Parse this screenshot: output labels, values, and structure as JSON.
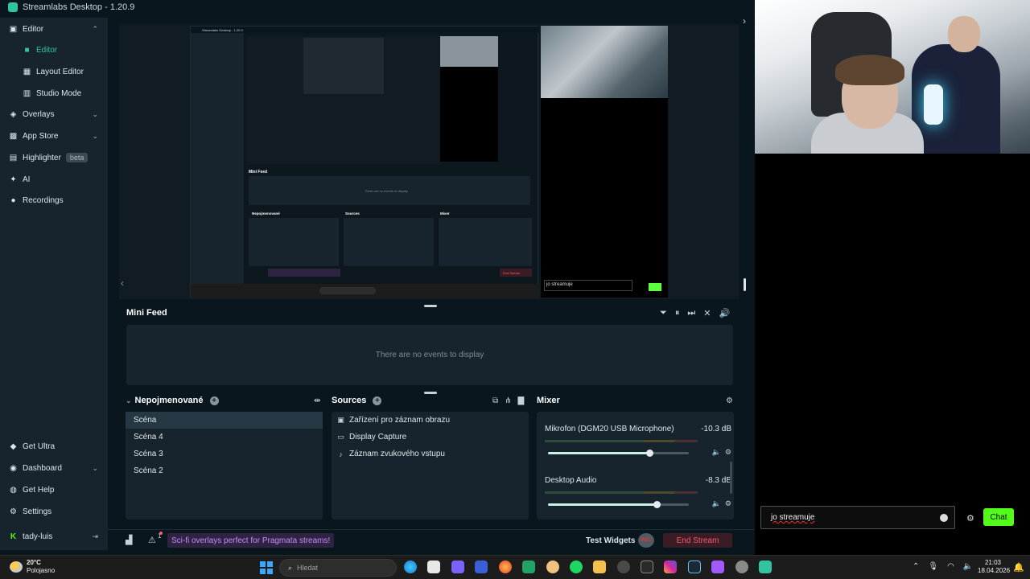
{
  "window": {
    "title": "Streamlabs Desktop - 1.20.9"
  },
  "sidebar": {
    "editor_group": {
      "label": "Editor",
      "icon": "palette-icon"
    },
    "editor_items": [
      {
        "label": "Editor",
        "icon": "edit-icon",
        "active": true
      },
      {
        "label": "Layout Editor",
        "icon": "layout-icon"
      },
      {
        "label": "Studio Mode",
        "icon": "studio-icon"
      }
    ],
    "nav": [
      {
        "label": "Overlays",
        "icon": "overlays-icon"
      },
      {
        "label": "App Store",
        "icon": "store-icon"
      },
      {
        "label": "Highlighter",
        "icon": "highlighter-icon",
        "badge": "beta"
      },
      {
        "label": "AI",
        "icon": "ai-sparkle-icon"
      },
      {
        "label": "Recordings",
        "icon": "recordings-icon"
      }
    ],
    "bottom": [
      {
        "label": "Get Ultra",
        "icon": "ultra-icon"
      },
      {
        "label": "Dashboard",
        "icon": "dashboard-icon"
      },
      {
        "label": "Get Help",
        "icon": "help-icon"
      },
      {
        "label": "Settings",
        "icon": "gear-icon"
      }
    ],
    "user": {
      "name": "tady-luis"
    }
  },
  "mini_feed": {
    "title": "Mini Feed",
    "empty_text": "There are no events to display"
  },
  "scenes": {
    "title": "Nepojmenované",
    "items": [
      "Scéna",
      "Scéna 4",
      "Scéna 3",
      "Scéna 2"
    ]
  },
  "sources": {
    "title": "Sources",
    "items": [
      {
        "label": "Zařízení pro záznam obrazu",
        "icon": "camera-icon"
      },
      {
        "label": "Display Capture",
        "icon": "monitor-icon"
      },
      {
        "label": "Záznam zvukového vstupu",
        "icon": "microphone-icon"
      }
    ]
  },
  "mixer": {
    "title": "Mixer",
    "channels": [
      {
        "name": "Mikrofon (DGM20 USB Microphone)",
        "db": "-10.3 dB",
        "level": 0.72
      },
      {
        "name": "Desktop Audio",
        "db": "-8.3 dB",
        "level": 0.77
      }
    ]
  },
  "footer": {
    "promo": "Sci-fi overlays perfect for Pragmata streams!",
    "notif_count": "1",
    "test_widgets": "Test Widgets",
    "rec_label": "REC",
    "end_stream": "End Stream"
  },
  "chat": {
    "input_value": "jo streamuje",
    "send_label": "Chat"
  },
  "taskbar": {
    "weather_temp": "20°C",
    "weather_desc": "Polojasno",
    "search_placeholder": "Hledat",
    "time": "21:03",
    "date": "18.04.2026"
  },
  "inner_preview": {
    "title": "Streamlabs Desktop - 1.20.9",
    "chat_text": "jo streamuje",
    "mini_feed": "Mini Feed",
    "empty_text": "There are no events to display",
    "scenes_title": "Nepojmenované",
    "sources_title": "Sources",
    "mixer_title": "Mixer",
    "end_stream": "End Stream"
  },
  "colors": {
    "accent": "#31c3a2",
    "chat_green": "#53fc18",
    "end_stream": "#ff5a67",
    "promo": "#c98cff"
  }
}
